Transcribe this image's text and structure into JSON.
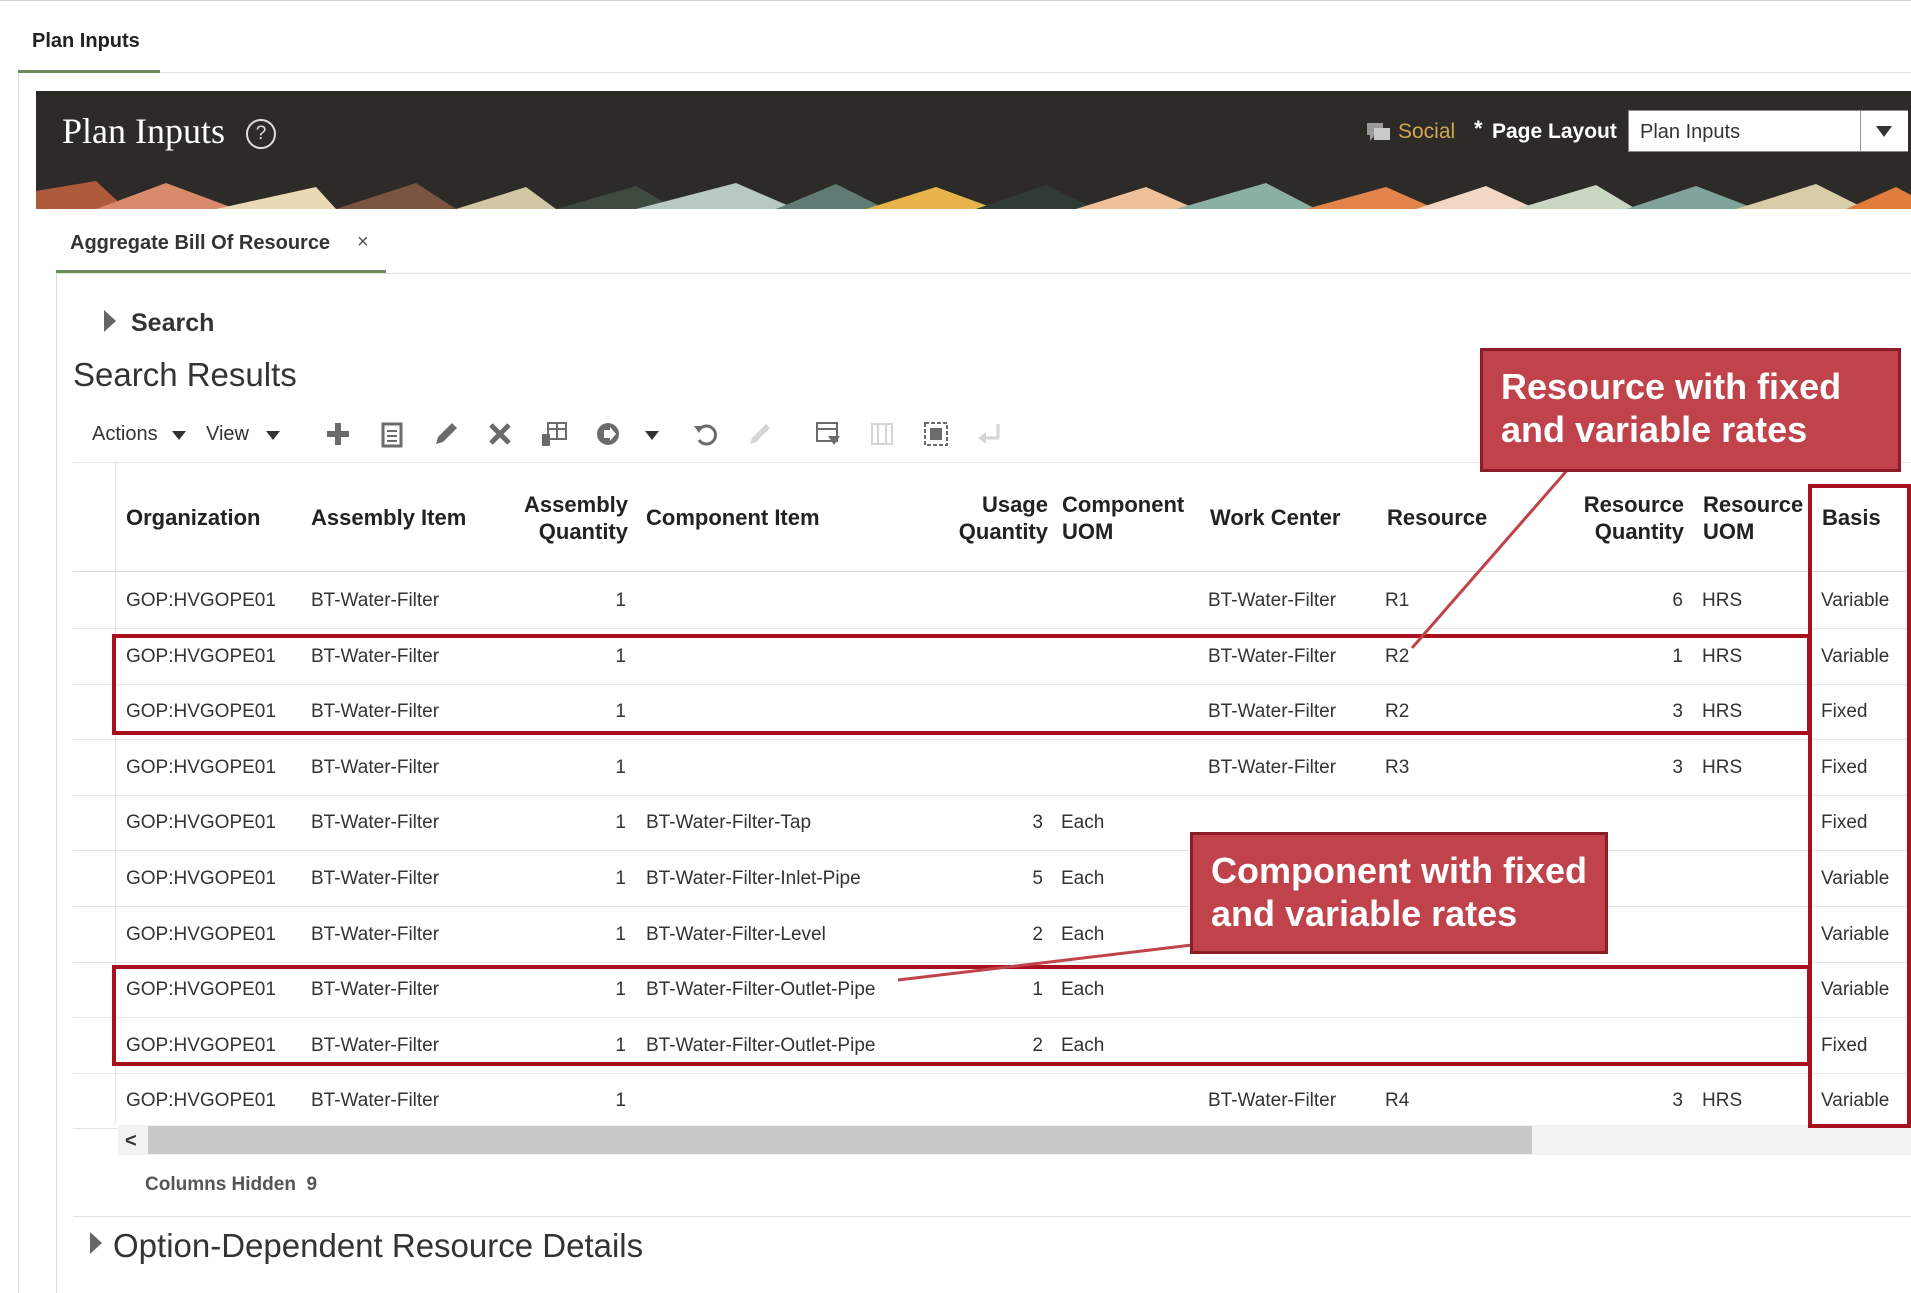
{
  "page_tab": "Plan Inputs",
  "header": {
    "title": "Plan Inputs",
    "help_glyph": "?",
    "social_label": "Social",
    "page_layout_required": "*",
    "page_layout_label": "Page Layout",
    "page_layout_value": "Plan Inputs"
  },
  "content_tab": {
    "label": "Aggregate Bill Of Resource",
    "close_glyph": "×"
  },
  "search": {
    "label": "Search"
  },
  "results_title": "Search Results",
  "toolbar": {
    "actions_label": "Actions",
    "view_label": "View"
  },
  "columns": {
    "organization": "Organization",
    "assembly_item": "Assembly Item",
    "assembly_quantity": [
      "Assembly",
      "Quantity"
    ],
    "component_item": "Component Item",
    "usage_quantity": [
      "Usage",
      "Quantity"
    ],
    "component_uom": [
      "Component",
      "UOM"
    ],
    "work_center": "Work Center",
    "resource": "Resource",
    "resource_quantity": [
      "Resource",
      "Quantity"
    ],
    "resource_uom": [
      "Resource",
      "UOM"
    ],
    "basis": "Basis"
  },
  "rows": [
    {
      "org": "GOP:HVGOPE01",
      "assembly": "BT-Water-Filter",
      "asm_qty": "1",
      "component": "",
      "usage_qty": "",
      "comp_uom": "",
      "work_center": "BT-Water-Filter",
      "resource": "R1",
      "res_qty": "6",
      "res_uom": "HRS",
      "basis": "Variable"
    },
    {
      "org": "GOP:HVGOPE01",
      "assembly": "BT-Water-Filter",
      "asm_qty": "1",
      "component": "",
      "usage_qty": "",
      "comp_uom": "",
      "work_center": "BT-Water-Filter",
      "resource": "R2",
      "res_qty": "1",
      "res_uom": "HRS",
      "basis": "Variable"
    },
    {
      "org": "GOP:HVGOPE01",
      "assembly": "BT-Water-Filter",
      "asm_qty": "1",
      "component": "",
      "usage_qty": "",
      "comp_uom": "",
      "work_center": "BT-Water-Filter",
      "resource": "R2",
      "res_qty": "3",
      "res_uom": "HRS",
      "basis": "Fixed"
    },
    {
      "org": "GOP:HVGOPE01",
      "assembly": "BT-Water-Filter",
      "asm_qty": "1",
      "component": "",
      "usage_qty": "",
      "comp_uom": "",
      "work_center": "BT-Water-Filter",
      "resource": "R3",
      "res_qty": "3",
      "res_uom": "HRS",
      "basis": "Fixed"
    },
    {
      "org": "GOP:HVGOPE01",
      "assembly": "BT-Water-Filter",
      "asm_qty": "1",
      "component": "BT-Water-Filter-Tap",
      "usage_qty": "3",
      "comp_uom": "Each",
      "work_center": "",
      "resource": "",
      "res_qty": "",
      "res_uom": "",
      "basis": "Fixed"
    },
    {
      "org": "GOP:HVGOPE01",
      "assembly": "BT-Water-Filter",
      "asm_qty": "1",
      "component": "BT-Water-Filter-Inlet-Pipe",
      "usage_qty": "5",
      "comp_uom": "Each",
      "work_center": "",
      "resource": "",
      "res_qty": "",
      "res_uom": "",
      "basis": "Variable"
    },
    {
      "org": "GOP:HVGOPE01",
      "assembly": "BT-Water-Filter",
      "asm_qty": "1",
      "component": "BT-Water-Filter-Level",
      "usage_qty": "2",
      "comp_uom": "Each",
      "work_center": "",
      "resource": "",
      "res_qty": "",
      "res_uom": "",
      "basis": "Variable"
    },
    {
      "org": "GOP:HVGOPE01",
      "assembly": "BT-Water-Filter",
      "asm_qty": "1",
      "component": "BT-Water-Filter-Outlet-Pipe",
      "usage_qty": "1",
      "comp_uom": "Each",
      "work_center": "",
      "resource": "",
      "res_qty": "",
      "res_uom": "",
      "basis": "Variable"
    },
    {
      "org": "GOP:HVGOPE01",
      "assembly": "BT-Water-Filter",
      "asm_qty": "1",
      "component": "BT-Water-Filter-Outlet-Pipe",
      "usage_qty": "2",
      "comp_uom": "Each",
      "work_center": "",
      "resource": "",
      "res_qty": "",
      "res_uom": "",
      "basis": "Fixed"
    },
    {
      "org": "GOP:HVGOPE01",
      "assembly": "BT-Water-Filter",
      "asm_qty": "1",
      "component": "",
      "usage_qty": "",
      "comp_uom": "",
      "work_center": "BT-Water-Filter",
      "resource": "R4",
      "res_qty": "3",
      "res_uom": "HRS",
      "basis": "Variable"
    }
  ],
  "columns_hidden": {
    "label": "Columns Hidden",
    "count": "9"
  },
  "option_section": "Option-Dependent Resource Details",
  "annotations": {
    "resource_callout": [
      "Resource with fixed",
      "and variable rates"
    ],
    "component_callout": [
      "Component with fixed",
      "and variable rates"
    ]
  },
  "colors": {
    "header_bg": "#2d2b28",
    "social": "#d4a64e",
    "tab_accent": "#6d8e5a",
    "highlight": "#a9101d",
    "callout_bg": "#c0424b"
  },
  "icons": [
    "help-icon",
    "social-icon",
    "expand-icon",
    "add-icon",
    "duplicate-icon",
    "edit-icon",
    "delete-icon",
    "format-icon",
    "go-icon",
    "undo-icon",
    "pen-icon",
    "freeze-icon",
    "detach-icon",
    "wrap-icon",
    "return-icon",
    "scroll-left-icon"
  ]
}
